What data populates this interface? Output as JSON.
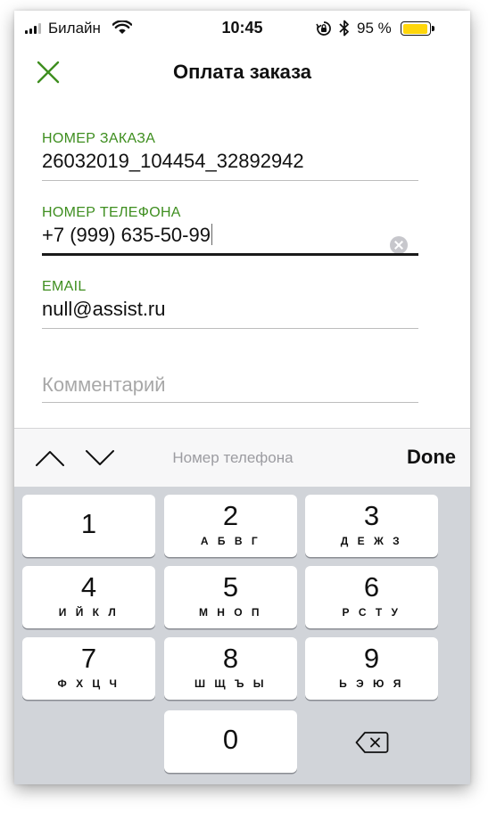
{
  "status_bar": {
    "carrier": "Билайн",
    "time": "10:45",
    "battery_percent": "95 %",
    "battery_level": 0.95,
    "battery_color": "#ffd60a"
  },
  "header": {
    "title": "Оплата заказа",
    "close_icon": "close-icon",
    "accent_color": "#3e8e1f"
  },
  "form": {
    "order_number": {
      "label": "НОМЕР ЗАКАЗА",
      "value": "26032019_104454_32892942"
    },
    "phone": {
      "label": "НОМЕР ТЕЛЕФОНА",
      "value": "+7 (999) 635-50-99"
    },
    "email": {
      "label": "EMAIL",
      "value": "null@assist.ru"
    },
    "comment": {
      "placeholder": "Комментарий",
      "value": ""
    }
  },
  "keyboard": {
    "accessory_title": "Номер телефона",
    "done_label": "Done",
    "keys": [
      {
        "digit": "1",
        "letters": ""
      },
      {
        "digit": "2",
        "letters": "А Б В Г"
      },
      {
        "digit": "3",
        "letters": "Д Е Ж З"
      },
      {
        "digit": "4",
        "letters": "И Й К Л"
      },
      {
        "digit": "5",
        "letters": "М Н О П"
      },
      {
        "digit": "6",
        "letters": "Р С Т У"
      },
      {
        "digit": "7",
        "letters": "Ф Х Ц Ч"
      },
      {
        "digit": "8",
        "letters": "Ш Щ Ъ Ы"
      },
      {
        "digit": "9",
        "letters": "Ь Э Ю Я"
      },
      {
        "digit": "0",
        "letters": ""
      }
    ]
  }
}
